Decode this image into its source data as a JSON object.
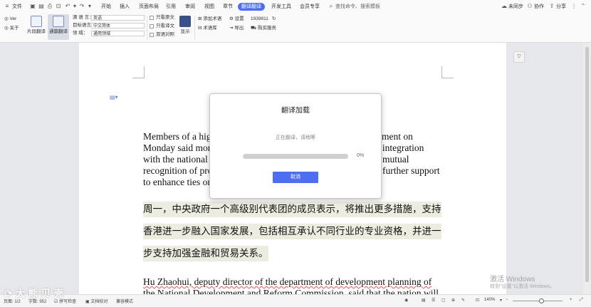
{
  "tabs": {
    "menu": "文件",
    "items": [
      "开始",
      "插入",
      "页面布局",
      "引用",
      "审阅",
      "视图",
      "章节",
      "翻译翻译",
      "开发工具",
      "会员专享"
    ],
    "search_placeholder": "查找命令、搜索模板",
    "sync": "未同步",
    "collab": "协作",
    "share": "分享"
  },
  "ribbon": {
    "ver": "Ver",
    "about": "关于",
    "para_translate": "片段翻译",
    "full_translate": "通篇翻译",
    "source_label": "源 语 言：",
    "source_value": "英语",
    "target_label": "目标语言：",
    "target_value": "中文简体",
    "field_label": "领      域：",
    "field_value": "通用领域",
    "only_original": "只看原文",
    "only_translation": "只看译文",
    "bilingual": "双语对照",
    "display": "显示",
    "add_term": "添加术语",
    "term_base": "术语库",
    "settings": "设置",
    "export": "导出",
    "balance": "1939811",
    "buy": "购买服务"
  },
  "document": {
    "en_para1": [
      "Members of a hig",
      "Monday said mor",
      "with the national",
      "recognition of pro",
      "to enhance ties on"
    ],
    "en_para1_right": [
      "ment on",
      "r integration",
      "mutual",
      "further support",
      ""
    ],
    "zh_para": [
      "周一，中央政府一个高级别代表团的成员表示，将推出更多措施，支持",
      "香港进一步融入国家发展，包括相互承认不同行业的专业资格，并进一",
      "步支持加强金融和贸易关系。"
    ],
    "en_para2_line1": "Hu Zhaohui, deputy director of the department of development planning of",
    "en_para2_line2": "the National Development and Reform Commission, said that the nation will"
  },
  "dialog": {
    "title": "翻译加载",
    "status": "正在翻译，请稍等",
    "progress": 0,
    "progress_text": "0%",
    "cancel": "取消"
  },
  "statusbar": {
    "page": "页面: 1/2",
    "words": "字数: 952",
    "spell": "拼写检查",
    "proof": "文档校对",
    "compat": "兼容模式",
    "zoom": "140%"
  },
  "watermark": {
    "line1": "激活 Windows",
    "line2": "转到\"设置\"以激活 Windows。",
    "logo": "大 熊 贝 壳"
  },
  "colors": {
    "accent": "#4e6ef2",
    "progress_track": "#cfcfcf",
    "highlight": "#ecece0"
  }
}
